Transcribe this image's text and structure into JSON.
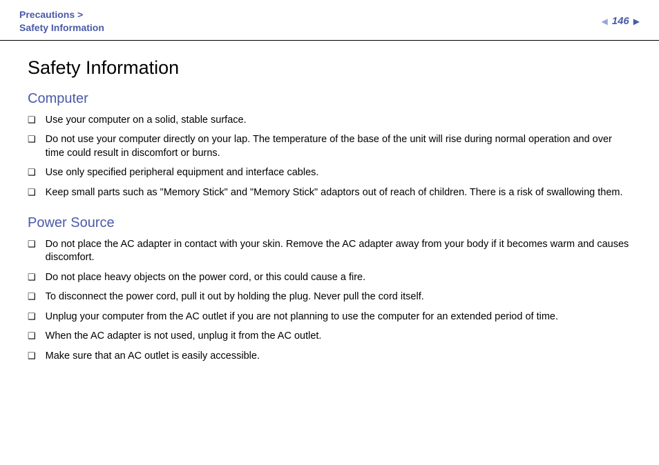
{
  "header": {
    "breadcrumb_line1": "Precautions >",
    "breadcrumb_line2": "Safety Information",
    "page_number": "146"
  },
  "title": "Safety Information",
  "sections": [
    {
      "heading": "Computer",
      "items": [
        "Use your computer on a solid, stable surface.",
        "Do not use your computer directly on your lap. The temperature of the base of the unit will rise during normal operation and over time could result in discomfort or burns.",
        "Use only specified peripheral equipment and interface cables.",
        "Keep small parts such as \"Memory Stick\" and \"Memory Stick\" adaptors out of reach of children. There is a risk of swallowing them."
      ]
    },
    {
      "heading": "Power Source",
      "items": [
        "Do not place the AC adapter in contact with your skin. Remove the AC adapter away from your body if it becomes warm and causes discomfort.",
        "Do not place heavy objects on the power cord, or this could cause a fire.",
        "To disconnect the power cord, pull it out by holding the plug. Never pull the cord itself.",
        "Unplug your computer from the AC outlet if you are not planning to use the computer for an extended period of time.",
        "When the AC adapter is not used, unplug it from the AC outlet.",
        "Make sure that an AC outlet is easily accessible."
      ]
    }
  ]
}
